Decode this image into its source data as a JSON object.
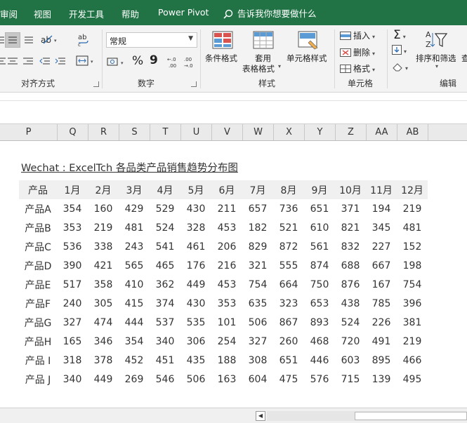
{
  "menu": {
    "items": [
      "审阅",
      "视图",
      "开发工具",
      "帮助",
      "Power Pivot"
    ],
    "tell_me": "告诉我你想要做什么"
  },
  "ribbon": {
    "alignment": {
      "label": "对齐方式"
    },
    "number": {
      "label": "数字",
      "format_value": "常规",
      "percent": "%",
      "comma": "9"
    },
    "styles": {
      "label": "样式",
      "conditional_format": "条件格式",
      "table_format_line1": "套用",
      "table_format_line2": "表格格式",
      "cell_styles": "单元格样式"
    },
    "cells": {
      "label": "单元格",
      "insert": "插入",
      "delete": "删除",
      "format": "格式"
    },
    "editing": {
      "label": "编辑",
      "sort_filter": "排序和筛选",
      "find_partial": "查"
    }
  },
  "columns": [
    "P",
    "Q",
    "R",
    "S",
    "T",
    "U",
    "V",
    "W",
    "X",
    "Y",
    "Z",
    "AA",
    "AB"
  ],
  "sheet": {
    "title": "Wechat : ExcelTch  各品类产品销售趋势分布图",
    "header": [
      "产品",
      "1月",
      "2月",
      "3月",
      "4月",
      "5月",
      "6月",
      "7月",
      "8月",
      "9月",
      "10月",
      "11月",
      "12月"
    ],
    "rows": [
      [
        "产品A",
        "354",
        "160",
        "429",
        "529",
        "430",
        "211",
        "657",
        "736",
        "651",
        "371",
        "194",
        "219"
      ],
      [
        "产品B",
        "353",
        "219",
        "481",
        "524",
        "328",
        "453",
        "182",
        "521",
        "610",
        "821",
        "345",
        "481"
      ],
      [
        "产品C",
        "536",
        "338",
        "243",
        "541",
        "461",
        "206",
        "829",
        "872",
        "561",
        "832",
        "227",
        "152"
      ],
      [
        "产品D",
        "390",
        "421",
        "565",
        "465",
        "176",
        "216",
        "321",
        "555",
        "874",
        "688",
        "667",
        "198"
      ],
      [
        "产品E",
        "517",
        "358",
        "410",
        "362",
        "449",
        "453",
        "754",
        "664",
        "750",
        "876",
        "167",
        "754"
      ],
      [
        "产品F",
        "240",
        "305",
        "415",
        "374",
        "430",
        "353",
        "635",
        "323",
        "653",
        "438",
        "785",
        "396"
      ],
      [
        "产品G",
        "327",
        "474",
        "444",
        "537",
        "535",
        "101",
        "506",
        "867",
        "893",
        "524",
        "226",
        "381"
      ],
      [
        "产品H",
        "165",
        "346",
        "354",
        "340",
        "306",
        "254",
        "327",
        "260",
        "468",
        "720",
        "491",
        "219"
      ],
      [
        "产品 I",
        "318",
        "378",
        "452",
        "451",
        "435",
        "188",
        "308",
        "651",
        "446",
        "603",
        "895",
        "466"
      ],
      [
        "产品 J",
        "340",
        "449",
        "269",
        "546",
        "506",
        "163",
        "604",
        "475",
        "576",
        "715",
        "139",
        "495"
      ]
    ]
  },
  "colors": {
    "menu_bg": "#217346",
    "ribbon_bg": "#f3f3f3",
    "header_bg": "#eaeaea"
  }
}
